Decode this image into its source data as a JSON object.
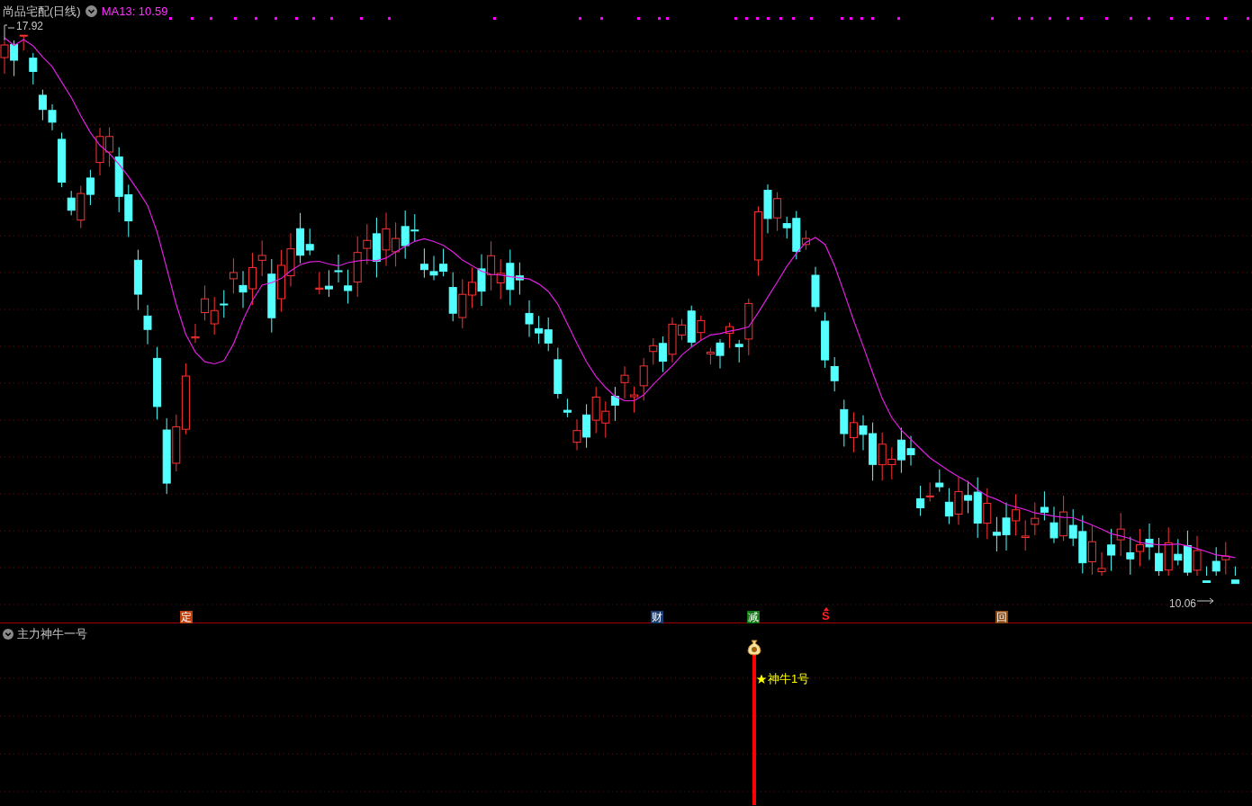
{
  "chart": {
    "title": "尚品宅配(日线)",
    "indicator": "MA13: 10.59",
    "high_label": "17.92",
    "low_label": "10.06",
    "markers": [
      {
        "text": "定",
        "kind": "badge",
        "color": "#c0400c"
      },
      {
        "text": "财",
        "kind": "badge",
        "color": "#1a3c6e"
      },
      {
        "text": "减",
        "kind": "badge",
        "color": "#117a11"
      },
      {
        "text": "S",
        "kind": "letter",
        "color": "#ff2020"
      },
      {
        "text": "回",
        "kind": "badge",
        "color": "#8a4a12"
      }
    ]
  },
  "sub_panel": {
    "title": "主力神牛一号",
    "signal_label": "神牛1号"
  }
}
